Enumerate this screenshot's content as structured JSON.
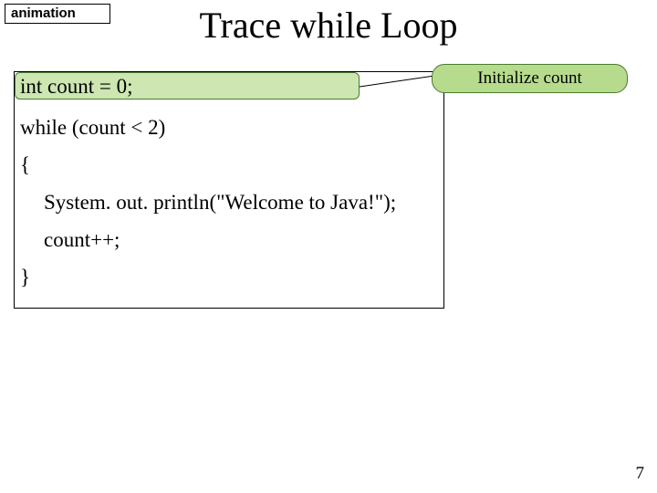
{
  "tag": "animation",
  "title": "Trace while Loop",
  "callout": "Initialize count",
  "code": {
    "line1": "int count = 0;",
    "line2": "while (count < 2)",
    "line3": "{",
    "line4": "System. out. println(\"Welcome to Java!\");",
    "line5": "count++;",
    "line6": "}"
  },
  "page_number": "7"
}
